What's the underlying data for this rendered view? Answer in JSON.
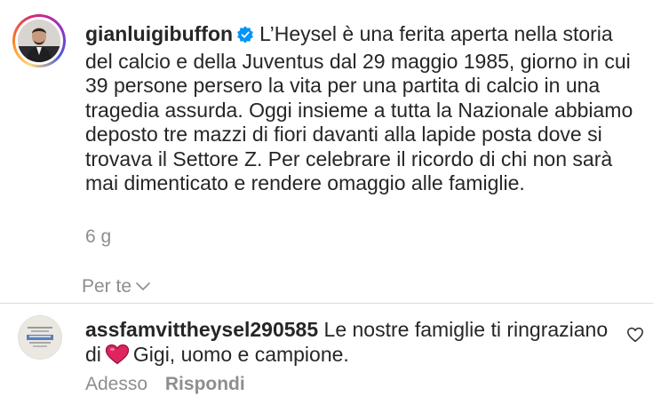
{
  "post": {
    "username": "gianluigibuffon",
    "verified_icon": "verified-badge-icon",
    "caption": "L’Heysel è una ferita aperta nella storia del calcio e della Juventus dal 29 maggio 1985, giorno in cui 39 persone persero la vita per una partita di calcio in una tragedia assurda. Oggi insieme a tutta la Nazionale abbiamo deposto tre mazzi di fiori davanti alla lapide posta dove si trovava il Settore Z. Per celebrare il ricordo di chi non sarà mai dimenticato e rendere omaggio alle famiglie.",
    "age": "6 g",
    "translate_label": "Per te",
    "translate_icon": "chevron-down-icon",
    "story_ring_colors": [
      "#feda75",
      "#fa7e1e",
      "#d62976",
      "#962fbf",
      "#4f5bd5"
    ]
  },
  "reply": {
    "username": "assfamvittheysel290585",
    "text_before_emoji": "Le nostre famiglie ti ringraziano di",
    "emoji": "red-heart-emoji",
    "text_after_emoji": "Gigi, uomo e campione.",
    "time": "Adesso",
    "reply_label": "Rispondi",
    "like_icon": "heart-outline-icon"
  },
  "colors": {
    "text": "#262626",
    "secondary": "#8e8e8e",
    "verified": "#0095f6",
    "heart": "#e0245e",
    "divider": "#dbdbdb"
  }
}
